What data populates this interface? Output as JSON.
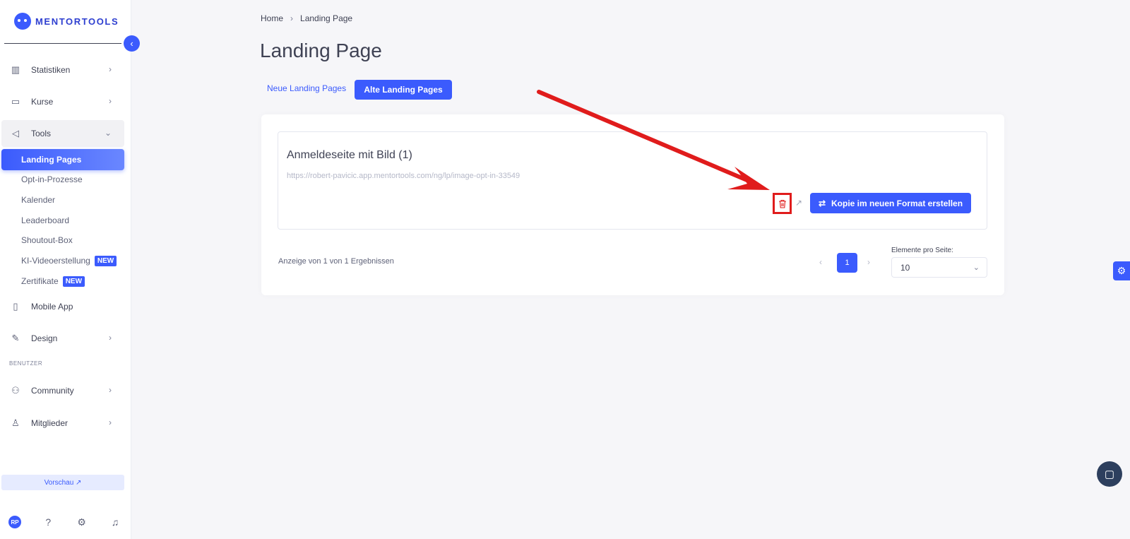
{
  "brand": {
    "name": "MENTORTOOLS"
  },
  "sidebar": {
    "items": [
      {
        "label": "Statistiken",
        "icon": "bar-chart-icon"
      },
      {
        "label": "Kurse",
        "icon": "book-icon"
      },
      {
        "label": "Tools",
        "icon": "megaphone-icon"
      }
    ],
    "tools_sub": [
      {
        "label": "Landing Pages"
      },
      {
        "label": "Opt-in-Prozesse"
      },
      {
        "label": "Kalender"
      },
      {
        "label": "Leaderboard"
      },
      {
        "label": "Shoutout-Box"
      },
      {
        "label": "KI-Videoerstellung",
        "badge": "NEW"
      },
      {
        "label": "Zertifikate",
        "badge": "NEW"
      }
    ],
    "items2": [
      {
        "label": "Mobile App",
        "icon": "phone-icon"
      },
      {
        "label": "Design",
        "icon": "pen-icon"
      }
    ],
    "section_label": "BENUTZER",
    "users_items": [
      {
        "label": "Community",
        "icon": "people-icon"
      },
      {
        "label": "Mitglieder",
        "icon": "user-icon"
      }
    ],
    "preview_label": "Vorschau ↗",
    "avatar_initials": "RP"
  },
  "breadcrumb": {
    "home": "Home",
    "current": "Landing Page"
  },
  "page": {
    "title": "Landing Page"
  },
  "tabs": {
    "new": "Neue Landing Pages",
    "old": "Alte Landing Pages"
  },
  "landing_page": {
    "title": "Anmeldeseite mit Bild (1)",
    "url": "https://robert-pavicic.app.mentortools.com/ng/lp/image-opt-in-33549",
    "copy_button": "Kopie im neuen Format erstellen"
  },
  "pagination": {
    "results_text": "Anzeige von 1 von 1 Ergebnissen",
    "current_page": "1",
    "per_page_label": "Elemente pro Seite:",
    "per_page_value": "10"
  },
  "colors": {
    "accent": "#3b5bfd",
    "highlight": "#e01c1c"
  }
}
